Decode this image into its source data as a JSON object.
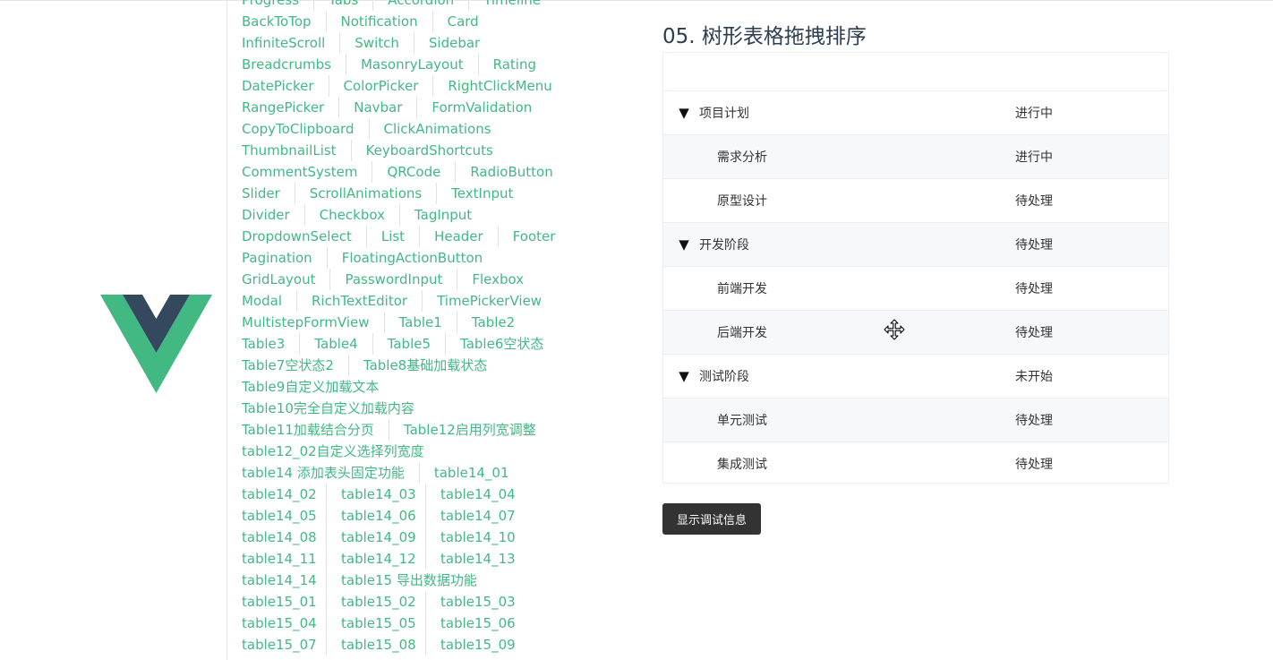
{
  "nav": {
    "rows": [
      [
        "Progress",
        "Tabs",
        "Accordion",
        "Timeline"
      ],
      [
        "BackToTop",
        "Notification",
        "Card"
      ],
      [
        "InfiniteScroll",
        "Switch",
        "Sidebar"
      ],
      [
        "Breadcrumbs",
        "MasonryLayout",
        "Rating"
      ],
      [
        "DatePicker",
        "ColorPicker",
        "RightClickMenu"
      ],
      [
        "RangePicker",
        "Navbar",
        "FormValidation"
      ],
      [
        "CopyToClipboard",
        "ClickAnimations"
      ],
      [
        "ThumbnailList",
        "KeyboardShortcuts"
      ],
      [
        "CommentSystem",
        "QRCode",
        "RadioButton"
      ],
      [
        "Slider",
        "ScrollAnimations",
        "TextInput"
      ],
      [
        "Divider",
        "Checkbox",
        "TagInput"
      ],
      [
        "DropdownSelect",
        "List",
        "Header",
        "Footer"
      ],
      [
        "Pagination",
        "FloatingActionButton"
      ],
      [
        "GridLayout",
        "PasswordInput",
        "Flexbox"
      ],
      [
        "Modal",
        "RichTextEditor",
        "TimePickerView"
      ],
      [
        "MultistepFormView",
        "Table1",
        "Table2"
      ],
      [
        "Table3",
        "Table4",
        "Table5",
        "Table6空状态"
      ],
      [
        "Table7空状态2",
        "Table8基础加载状态"
      ],
      [
        "Table9自定义加载文本"
      ],
      [
        "Table10完全自定义加载内容"
      ],
      [
        "Table11加载结合分页",
        "Table12启用列宽调整"
      ],
      [
        "table12_02自定义选择列宽度"
      ],
      [
        "table14 添加表头固定功能",
        "table14_01"
      ],
      [
        "table14_02",
        "table14_03",
        "table14_04"
      ],
      [
        "table14_05",
        "table14_06",
        "table14_07"
      ],
      [
        "table14_08",
        "table14_09",
        "table14_10"
      ],
      [
        "table14_11",
        "table14_12",
        "table14_13"
      ],
      [
        "table14_14",
        "table15 导出数据功能"
      ],
      [
        "table15_01",
        "table15_02",
        "table15_03"
      ],
      [
        "table15_04",
        "table15_05",
        "table15_06"
      ],
      [
        "table15_07",
        "table15_08",
        "table15_09"
      ]
    ]
  },
  "page": {
    "title": "05. 树形表格拖拽排序"
  },
  "tree": {
    "toggle_glyph": "▼",
    "rows": [
      {
        "name": "项目计划",
        "status": "进行中",
        "level": 0,
        "expanded": true
      },
      {
        "name": "需求分析",
        "status": "进行中",
        "level": 1
      },
      {
        "name": "原型设计",
        "status": "待处理",
        "level": 1
      },
      {
        "name": "开发阶段",
        "status": "待处理",
        "level": 0,
        "expanded": true
      },
      {
        "name": "前端开发",
        "status": "待处理",
        "level": 1
      },
      {
        "name": "后端开发",
        "status": "待处理",
        "level": 1
      },
      {
        "name": "测试阶段",
        "status": "未开始",
        "level": 0,
        "expanded": true
      },
      {
        "name": "单元测试",
        "status": "待处理",
        "level": 1
      },
      {
        "name": "集成测试",
        "status": "待处理",
        "level": 1
      }
    ]
  },
  "debug_button": {
    "label": "显示调试信息"
  },
  "colors": {
    "accent": "#42b983",
    "vue_dark": "#35495e",
    "button_bg": "#333333"
  },
  "icons": {
    "logo": "vue-logo-icon",
    "cursor": "move-cursor-icon",
    "toggle": "triangle-down-icon"
  }
}
